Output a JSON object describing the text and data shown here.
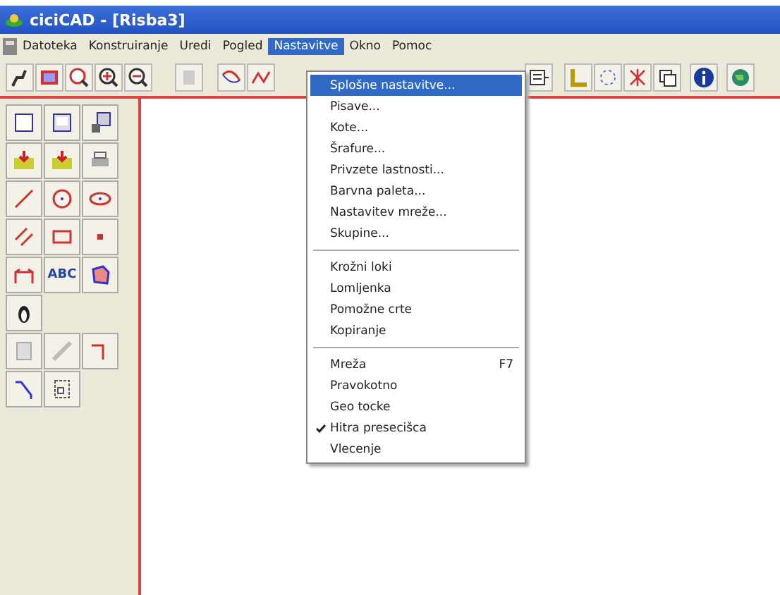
{
  "window": {
    "title": "ciciCAD - [Risba3]"
  },
  "menu_bar": [
    {
      "label": "Datoteka",
      "selected": false
    },
    {
      "label": "Konstruiranje",
      "selected": false
    },
    {
      "label": "Uredi",
      "selected": false
    },
    {
      "label": "Pogled",
      "selected": false
    },
    {
      "label": "Nastavitve",
      "selected": true
    },
    {
      "label": "Okno",
      "selected": false
    },
    {
      "label": "Pomoc",
      "selected": false
    }
  ],
  "open_menu": [
    {
      "kind": "item",
      "label": "Splošne nastavitve...",
      "selected": true,
      "checked": false
    },
    {
      "kind": "item",
      "label": "Pisave...",
      "selected": false,
      "checked": false
    },
    {
      "kind": "item",
      "label": "Kote...",
      "selected": false,
      "checked": false
    },
    {
      "kind": "item",
      "label": "Šrafure...",
      "selected": false,
      "checked": false
    },
    {
      "kind": "item",
      "label": "Privzete lastnosti...",
      "selected": false,
      "checked": false
    },
    {
      "kind": "item",
      "label": "Barvna paleta...",
      "selected": false,
      "checked": false
    },
    {
      "kind": "item",
      "label": "Nastavitev mreže...",
      "selected": false,
      "checked": false
    },
    {
      "kind": "item",
      "label": "Skupine...",
      "selected": false,
      "checked": false
    },
    {
      "kind": "separator"
    },
    {
      "kind": "item",
      "label": "Krožni loki",
      "selected": false,
      "checked": false
    },
    {
      "kind": "item",
      "label": "Lomljenka",
      "selected": false,
      "checked": false
    },
    {
      "kind": "item",
      "label": "Pomožne crte",
      "selected": false,
      "checked": false
    },
    {
      "kind": "item",
      "label": "Kopiranje",
      "selected": false,
      "checked": false
    },
    {
      "kind": "separator"
    },
    {
      "kind": "item",
      "label": "Mreža",
      "shortcut": "F7",
      "selected": false,
      "checked": false
    },
    {
      "kind": "item",
      "label": "Pravokotno",
      "selected": false,
      "checked": false
    },
    {
      "kind": "item",
      "label": "Geo tocke",
      "selected": false,
      "checked": false
    },
    {
      "kind": "item",
      "label": "Hitra presecišca",
      "selected": false,
      "checked": true
    },
    {
      "kind": "item",
      "label": "Vlecenje",
      "selected": false,
      "checked": false
    }
  ],
  "palette": {
    "text_tool": "ABC"
  }
}
